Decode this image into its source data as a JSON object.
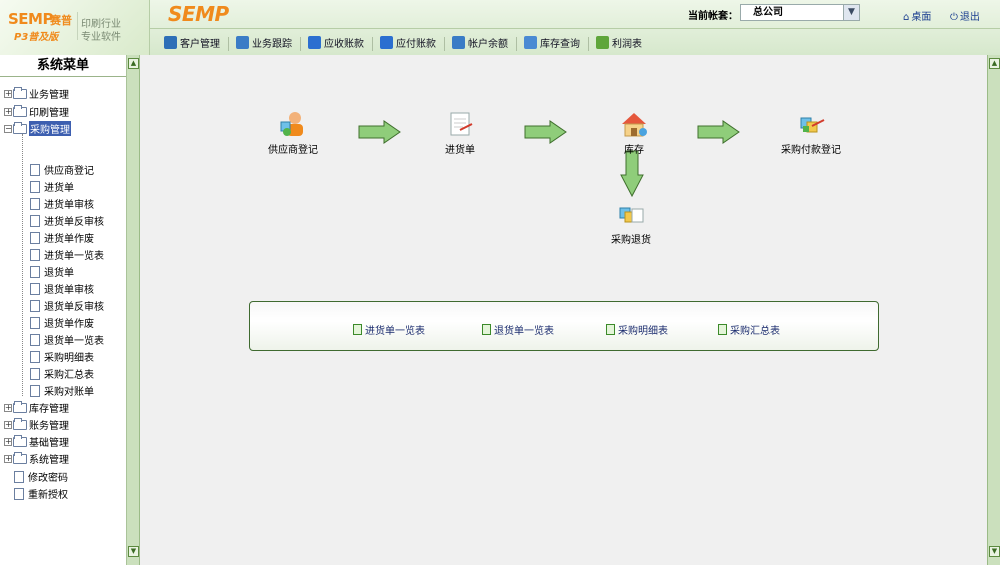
{
  "header": {
    "logo_main": "SEMP",
    "logo_cn": "赛普",
    "logo_sub": "P3普及版",
    "logo_tagline_1": "印刷行业",
    "logo_tagline_2": "专业软件",
    "brand": "SEMP",
    "account_label": "当前帐套：",
    "account_value": "总公司",
    "desktop_label": "桌面",
    "logout_label": "退出"
  },
  "menu": [
    {
      "label": "客户管理",
      "color": "#2d6fb7"
    },
    {
      "label": "业务跟踪",
      "color": "#3a7cc6"
    },
    {
      "label": "应收账款",
      "color": "#2b6fd0"
    },
    {
      "label": "应付账款",
      "color": "#2b6fd0"
    },
    {
      "label": "帐户余额",
      "color": "#3a7cc6"
    },
    {
      "label": "库存查询",
      "color": "#4a8ad3"
    },
    {
      "label": "利润表",
      "color": "#5fa63a"
    }
  ],
  "sidebar": {
    "title": "系统菜单",
    "groups": [
      {
        "label": "业务管理"
      },
      {
        "label": "印刷管理"
      },
      {
        "label": "采购管理"
      }
    ],
    "purchase_items": [
      {
        "label": "供应商登记"
      },
      {
        "label": "进货单"
      },
      {
        "label": "进货单审核"
      },
      {
        "label": "进货单反审核"
      },
      {
        "label": "进货单作废"
      },
      {
        "label": "进货单一览表"
      },
      {
        "label": "退货单"
      },
      {
        "label": "退货单审核"
      },
      {
        "label": "退货单反审核"
      },
      {
        "label": "退货单作废"
      },
      {
        "label": "退货单一览表"
      },
      {
        "label": "采购明细表"
      },
      {
        "label": "采购汇总表"
      },
      {
        "label": "采购对账单"
      }
    ],
    "groups_after": [
      {
        "label": "库存管理"
      },
      {
        "label": "账务管理"
      },
      {
        "label": "基础管理"
      },
      {
        "label": "系统管理"
      }
    ],
    "bottom_items": [
      {
        "label": "修改密码"
      },
      {
        "label": "重新授权"
      }
    ]
  },
  "flow": {
    "supplier": "供应商登记",
    "purchase_order": "进货单",
    "inventory": "库存",
    "payment": "采购付款登记",
    "return": "采购退货"
  },
  "reports": [
    {
      "label": "进货单一览表"
    },
    {
      "label": "退货单一览表"
    },
    {
      "label": "采购明细表"
    },
    {
      "label": "采购汇总表"
    }
  ]
}
